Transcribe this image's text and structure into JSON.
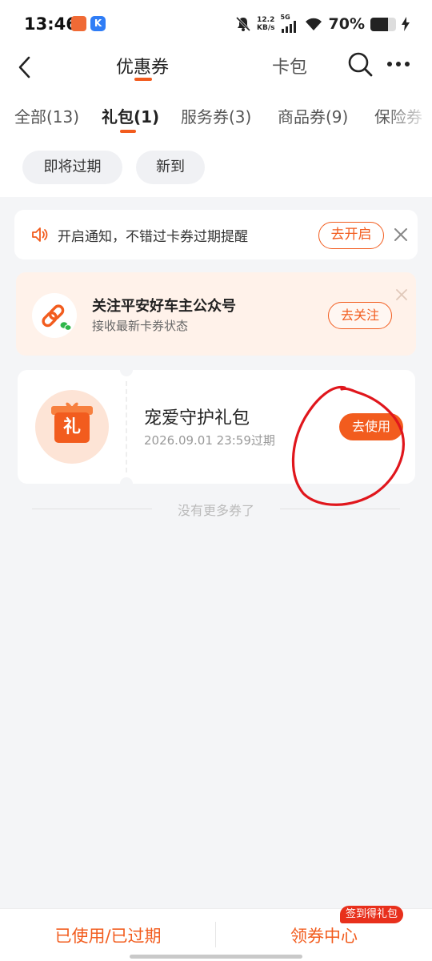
{
  "status_bar": {
    "time": "13:46",
    "app_icon_2_letter": "K",
    "net_speed_value": "12.2",
    "net_speed_unit": "KB/s",
    "network": "5G",
    "battery_percent": "70%",
    "battery_level": 0.7
  },
  "header": {
    "title": "优惠券",
    "wallet_tab": "卡包"
  },
  "tabs": [
    {
      "label": "全部(13)"
    },
    {
      "label": "礼包(1)"
    },
    {
      "label": "服务券(3)"
    },
    {
      "label": "商品券(9)"
    },
    {
      "label": "保险券"
    }
  ],
  "filters": [
    {
      "label": "即将过期"
    },
    {
      "label": "新到"
    }
  ],
  "notice": {
    "text": "开启通知，不错过卡券过期提醒",
    "button": "去开启"
  },
  "follow_card": {
    "title": "关注平安好车主公众号",
    "subtitle": "接收最新卡券状态",
    "button": "去关注"
  },
  "coupon": {
    "icon_char": "礼",
    "name": "宠爱守护礼包",
    "expiry": "2026.09.01 23:59过期",
    "button": "去使用"
  },
  "end_text": "没有更多券了",
  "bottom_bar": {
    "used_expired": "已使用/已过期",
    "coupon_center": "领券中心",
    "badge": "签到得礼包"
  },
  "colors": {
    "accent": "#f25c1e",
    "badge": "#e8301c",
    "annotation": "#e0161c"
  }
}
